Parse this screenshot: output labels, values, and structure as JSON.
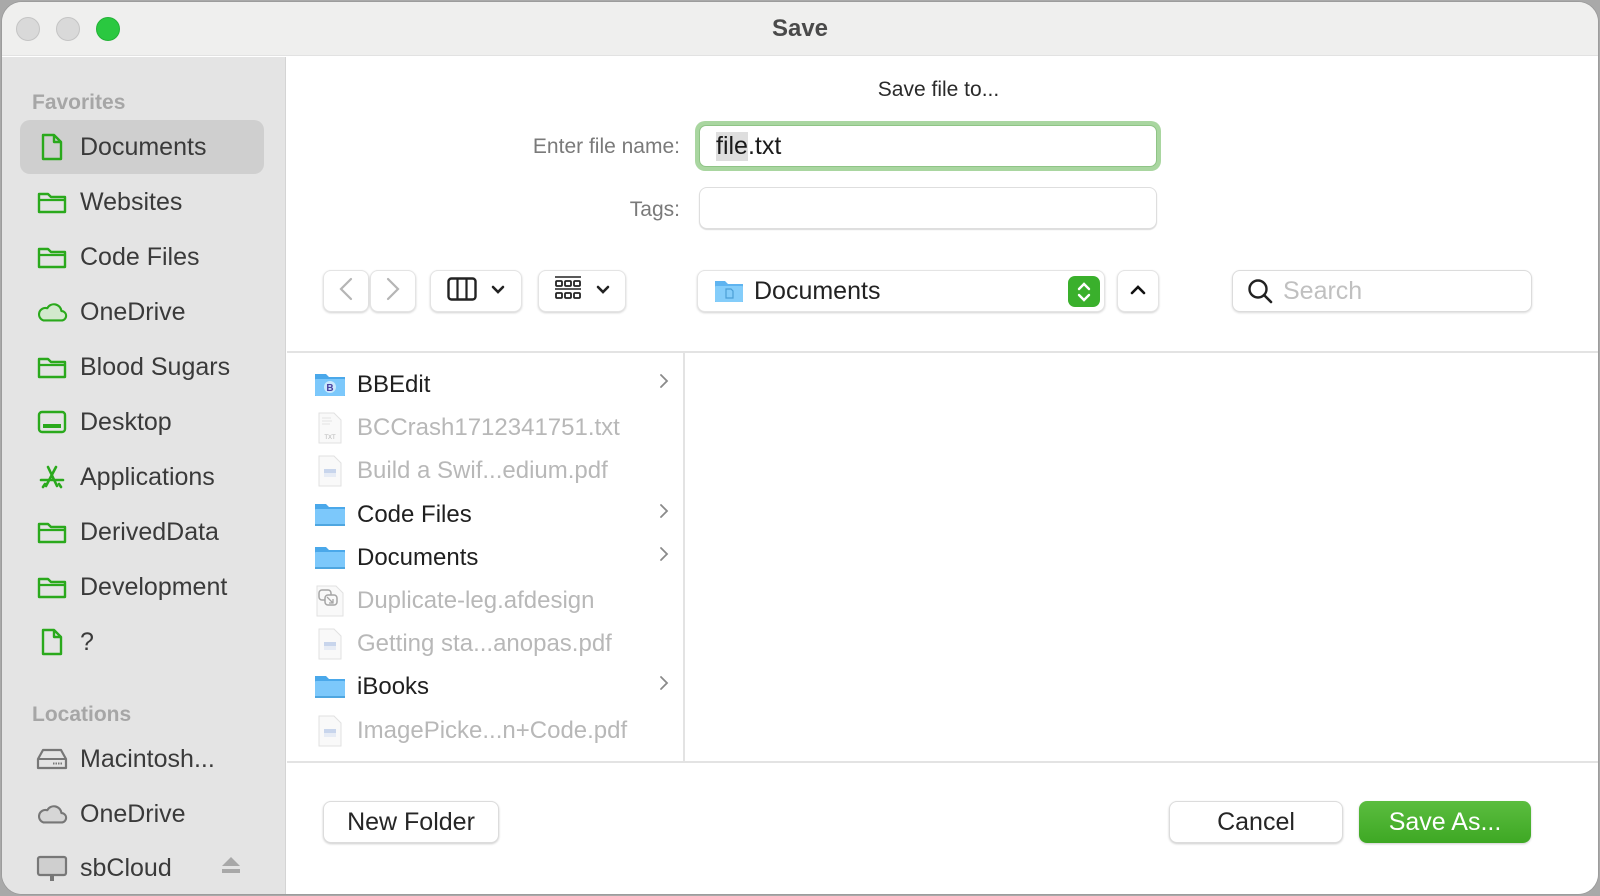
{
  "window": {
    "title": "Save"
  },
  "sidebar": {
    "favorites_heading": "Favorites",
    "favorites": [
      {
        "label": "Documents",
        "icon": "document-icon",
        "selected": true
      },
      {
        "label": "Websites",
        "icon": "folder-icon"
      },
      {
        "label": "Code Files",
        "icon": "folder-icon"
      },
      {
        "label": "OneDrive",
        "icon": "cloud-icon"
      },
      {
        "label": "Blood Sugars",
        "icon": "folder-icon"
      },
      {
        "label": "Desktop",
        "icon": "desktop-icon"
      },
      {
        "label": "Applications",
        "icon": "applications-icon"
      },
      {
        "label": "DerivedData",
        "icon": "folder-icon"
      },
      {
        "label": "Development",
        "icon": "folder-icon"
      },
      {
        "label": "?",
        "icon": "document-icon"
      }
    ],
    "locations_heading": "Locations",
    "locations": [
      {
        "label": "Macintosh...",
        "icon": "hard-drive-icon"
      },
      {
        "label": "OneDrive",
        "icon": "cloud-icon"
      },
      {
        "label": "sbCloud",
        "icon": "network-drive-icon",
        "ejectable": true
      }
    ]
  },
  "main": {
    "prompt": "Save file to...",
    "filename_label": "Enter file name:",
    "filename_value_selected": "file",
    "filename_value_ext": ".txt",
    "tags_label": "Tags:",
    "tags_value": "",
    "location_popup": "Documents",
    "search_placeholder": "Search",
    "view_mode_icon": "column-view-icon",
    "group_icon": "group-grid-icon"
  },
  "files": [
    {
      "name": "BBEdit",
      "type": "folder",
      "icon": "bbedit-folder-icon",
      "enabled": true
    },
    {
      "name": "BCCrash1712341751.txt",
      "type": "file",
      "icon": "txt-file-icon",
      "enabled": false
    },
    {
      "name": "Build a Swif...edium.pdf",
      "type": "file",
      "icon": "pdf-file-icon",
      "enabled": false
    },
    {
      "name": "Code Files",
      "type": "folder",
      "icon": "folder-icon",
      "enabled": true
    },
    {
      "name": "Documents",
      "type": "folder",
      "icon": "folder-icon",
      "enabled": true
    },
    {
      "name": "Duplicate-leg.afdesign",
      "type": "file",
      "icon": "afdesign-file-icon",
      "enabled": false
    },
    {
      "name": "Getting sta...anopas.pdf",
      "type": "file",
      "icon": "pdf-file-icon",
      "enabled": false
    },
    {
      "name": "iBooks",
      "type": "folder",
      "icon": "folder-icon",
      "enabled": true
    },
    {
      "name": "ImagePicke...n+Code.pdf",
      "type": "file",
      "icon": "pdf-file-icon",
      "enabled": false
    }
  ],
  "buttons": {
    "new_folder": "New Folder",
    "cancel": "Cancel",
    "save": "Save As..."
  },
  "colors": {
    "accent": "#3ab02c",
    "focus_ring": "#a9d6a0",
    "sidebar_icon": "#2aa91c"
  }
}
